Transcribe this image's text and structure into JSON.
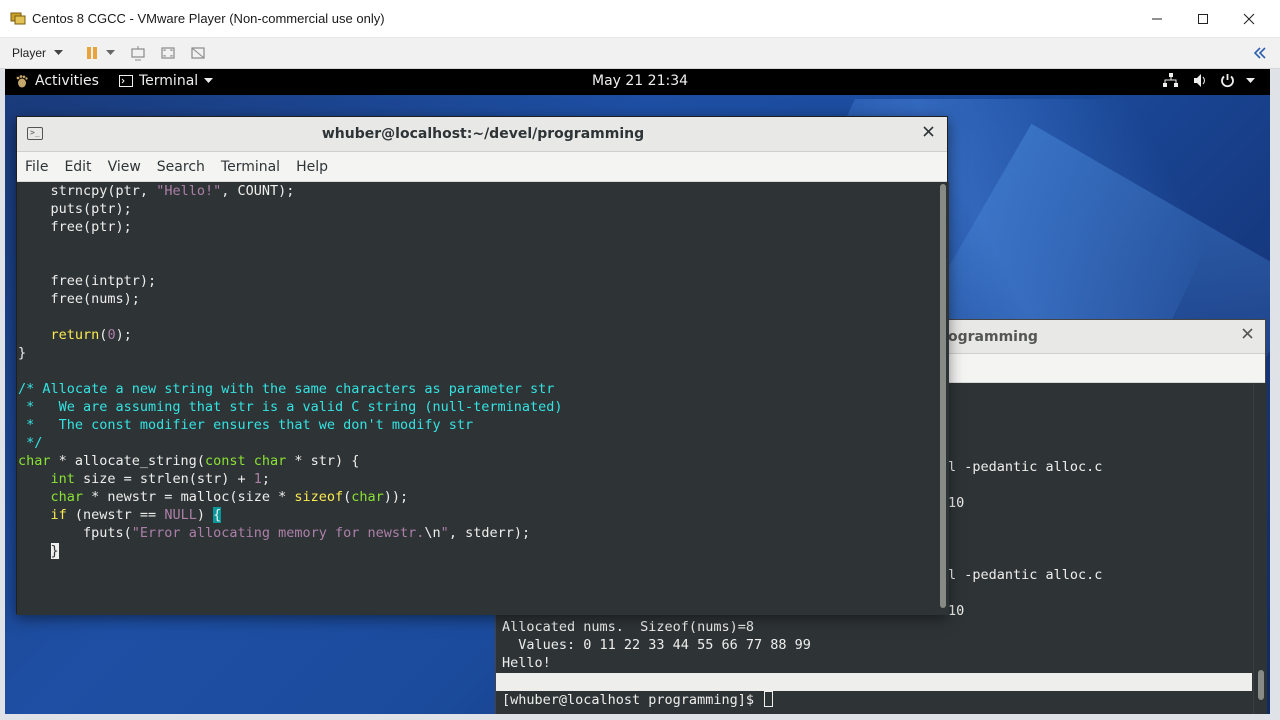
{
  "vm": {
    "title": "Centos 8 CGCC - VMware Player (Non-commercial use only)",
    "player_menu_label": "Player"
  },
  "gnome": {
    "activities_label": "Activities",
    "terminal_menu_label": "Terminal",
    "clock": "May 21  21:34"
  },
  "front_terminal": {
    "title": "whuber@localhost:~/devel/programming",
    "menu": [
      "File",
      "Edit",
      "View",
      "Search",
      "Terminal",
      "Help"
    ],
    "code_lines": [
      [
        [
          "    ",
          "plain"
        ],
        [
          "strncpy(ptr, ",
          "plain"
        ],
        [
          "\"Hello!\"",
          "str"
        ],
        [
          ", COUNT);",
          "plain"
        ]
      ],
      [
        [
          "    puts(ptr);",
          "plain"
        ]
      ],
      [
        [
          "    free(ptr);",
          "plain"
        ]
      ],
      [],
      [],
      [
        [
          "    free(intptr);",
          "plain"
        ]
      ],
      [
        [
          "    free(nums);",
          "plain"
        ]
      ],
      [],
      [
        [
          "    ",
          "plain"
        ],
        [
          "return",
          "kw"
        ],
        [
          "(",
          "plain"
        ],
        [
          "0",
          "num"
        ],
        [
          ");",
          "plain"
        ]
      ],
      [
        [
          "}",
          "plain"
        ]
      ],
      [],
      [
        [
          "/* Allocate a new string with the same characters as parameter str",
          "com"
        ]
      ],
      [
        [
          " *   We are assuming that str is a valid C string (null-terminated)",
          "com"
        ]
      ],
      [
        [
          " *   The const modifier ensures that we don't modify str",
          "com"
        ]
      ],
      [
        [
          " */",
          "com"
        ]
      ],
      [
        [
          "char",
          "type"
        ],
        [
          " * allocate_string(",
          "plain"
        ],
        [
          "const",
          "type"
        ],
        [
          " ",
          "plain"
        ],
        [
          "char",
          "type"
        ],
        [
          " * str) {",
          "plain"
        ]
      ],
      [
        [
          "    ",
          "plain"
        ],
        [
          "int",
          "type"
        ],
        [
          " size = strlen(str) + ",
          "plain"
        ],
        [
          "1",
          "num"
        ],
        [
          ";",
          "plain"
        ]
      ],
      [
        [
          "    ",
          "plain"
        ],
        [
          "char",
          "type"
        ],
        [
          " * newstr = malloc(size * ",
          "plain"
        ],
        [
          "sizeof",
          "kw"
        ],
        [
          "(",
          "plain"
        ],
        [
          "char",
          "type"
        ],
        [
          "));",
          "plain"
        ]
      ],
      [
        [
          "    ",
          "plain"
        ],
        [
          "if",
          "kw"
        ],
        [
          " (newstr == ",
          "plain"
        ],
        [
          "NULL",
          "str"
        ],
        [
          ") ",
          "plain"
        ],
        [
          "{",
          "brace-hl"
        ]
      ],
      [
        [
          "        fputs(",
          "plain"
        ],
        [
          "\"Error allocating memory for newstr.",
          "str"
        ],
        [
          "\\n",
          "plain"
        ],
        [
          "\"",
          "str"
        ],
        [
          ", stderr);",
          "plain"
        ]
      ],
      [
        [
          "    ",
          "plain"
        ],
        [
          "}",
          "cursor"
        ]
      ]
    ]
  },
  "back_terminal": {
    "title_fragment": "ogramming",
    "lines_right": [
      {
        "text": "l -pedantic alloc.c",
        "row": 0
      },
      {
        "text": "10",
        "row": 1
      },
      {
        "text": "l -pedantic alloc.c",
        "row": 2
      },
      {
        "text": "10",
        "row": 3
      }
    ],
    "output_lines": [
      "Allocated nums.  Sizeof(nums)=8",
      "  Values: 0 11 22 33 44 55 66 77 88 99",
      "Hello!"
    ],
    "prompt": "[whuber@localhost programming]$ "
  }
}
